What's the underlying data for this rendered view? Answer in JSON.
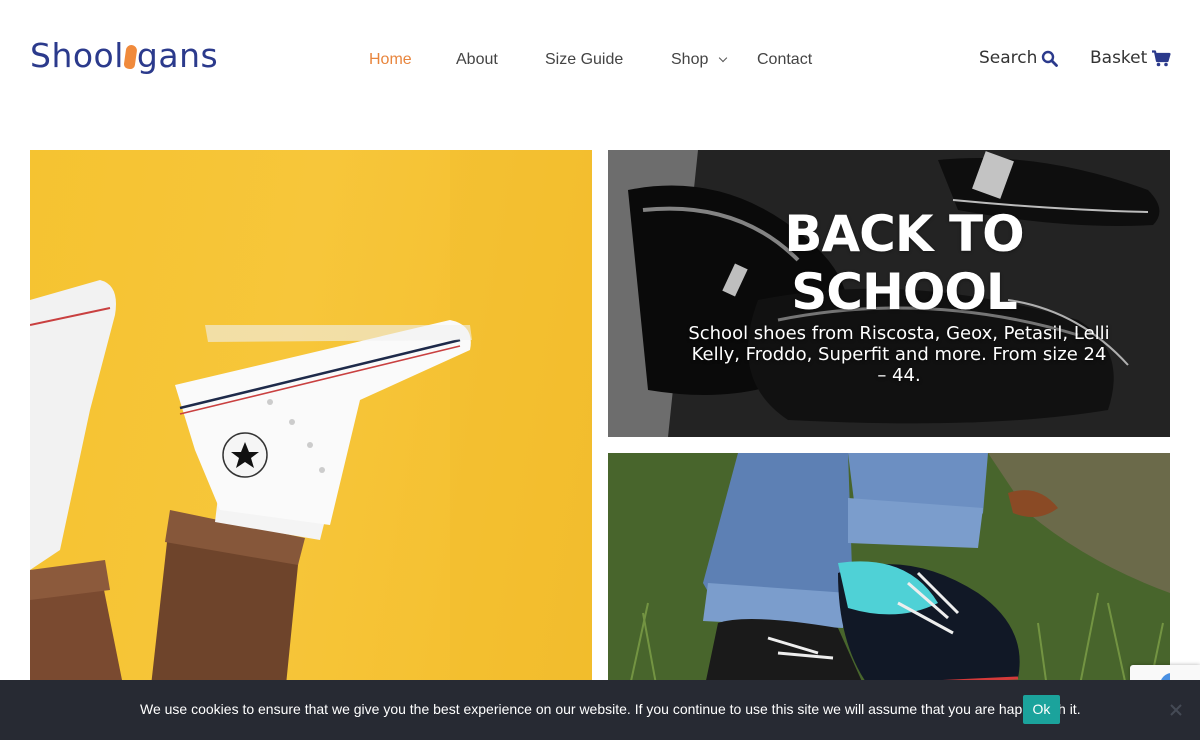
{
  "header": {
    "logo_text_a": "Shool",
    "logo_text_b": "gans",
    "nav": [
      {
        "label": "Home",
        "active": true
      },
      {
        "label": "About"
      },
      {
        "label": "Size Guide"
      },
      {
        "label": "Shop",
        "has_dropdown": true
      },
      {
        "label": "Contact"
      }
    ],
    "search_label": "Search",
    "basket_label": "Basket"
  },
  "hero": {
    "promo": {
      "title_line1": "BACK TO",
      "title_line2": "SCHOOL",
      "subtitle": "School shoes from Riscosta, Geox, Petasil, Lelli Kelly, Froddo, Superfit and more. From size 24 – 44."
    }
  },
  "cookie_notice": {
    "text": "We use cookies to ensure that we give you the best experience on our website. If you continue to use this site we will assume that you are happy with it.",
    "ok_label": "Ok"
  },
  "colors": {
    "brand": "#2b3a8c",
    "accent": "#e8853d",
    "cookie_bg": "#272a33",
    "cookie_button": "#1ba39c"
  }
}
